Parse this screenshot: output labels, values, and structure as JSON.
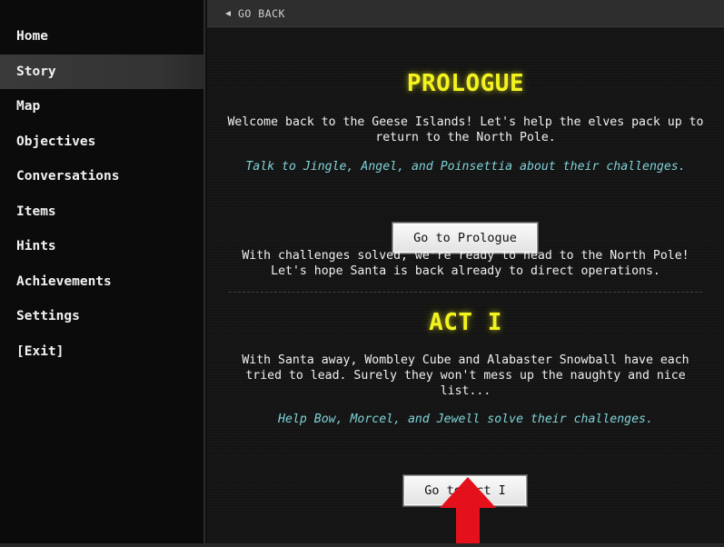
{
  "sidebar": {
    "items": [
      {
        "label": "Home"
      },
      {
        "label": "Story"
      },
      {
        "label": "Map"
      },
      {
        "label": "Objectives"
      },
      {
        "label": "Conversations"
      },
      {
        "label": "Items"
      },
      {
        "label": "Hints"
      },
      {
        "label": "Achievements"
      },
      {
        "label": "Settings"
      },
      {
        "label": "[Exit]"
      }
    ],
    "active": "Story"
  },
  "topbar": {
    "go_back_label": "GO BACK",
    "go_back_icon": "triangle-left-icon"
  },
  "prologue": {
    "title": "PROLOGUE",
    "intro": "Welcome back to the Geese Islands! Let's help the elves pack up to return to the North Pole.",
    "hint": "Talk to Jingle, Angel, and Poinsettia about their challenges.",
    "button_label": "Go to Prologue",
    "outro": "With challenges solved, we're ready to head to the North Pole! Let's hope Santa is back already to direct operations."
  },
  "act1": {
    "title": "ACT I",
    "intro": "With Santa away, Wombley Cube and Alabaster Snowball have each tried to lead. Surely they won't mess up the naughty and nice list...",
    "hint": "Help Bow, Morcel, and Jewell solve their challenges.",
    "button_label": "Go to Act I"
  },
  "annotation": {
    "arrow_color": "#e4101c",
    "arrow_icon": "red-up-arrow-icon"
  },
  "colors": {
    "title_yellow": "#f3f31f",
    "hint_cyan": "#7fd3d8",
    "background": "#141414"
  }
}
